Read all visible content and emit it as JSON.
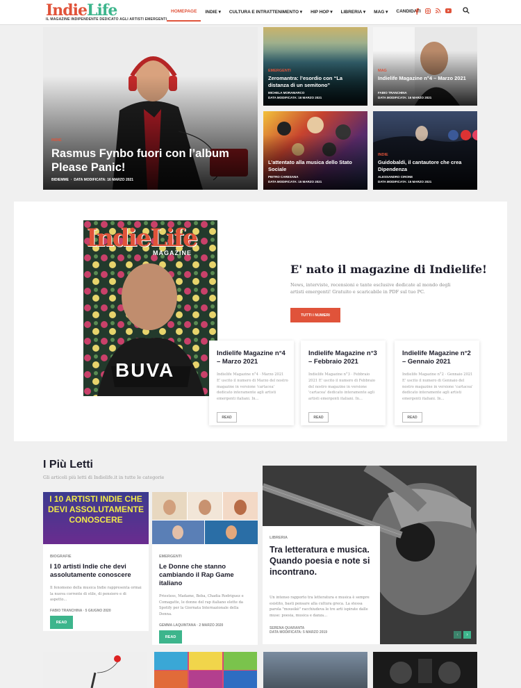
{
  "header": {
    "logo_part1": "Indie",
    "logo_part2": "Life",
    "tagline": "IL MAGAZINE INDIPENDENTE DEDICATO AGLI ARTISTI EMERGENTI",
    "nav": [
      "HOMEPAGE",
      "INDIE ▾",
      "CULTURA E INTRATTENIMENTO ▾",
      "HIP HOP ▾",
      "LIBRERIA ▾",
      "MAG ▾",
      "CANDIDATI"
    ]
  },
  "hero": {
    "main": {
      "category": "INDIE",
      "title": "Rasmus Fynbo fuori con l’album Please Panic!",
      "author": "BIDIEMME",
      "date": "DATA MODIFICATA: 16 MARZO 2021"
    },
    "tiles": [
      {
        "category": "EMERGENTI",
        "title": "Zeromantra: l’esordio con “La distanza di un semitono”",
        "author": "MICHELA MORAMARCO",
        "date": "DATA MODIFICATA: 16 MARZO 2021"
      },
      {
        "category": "MAG",
        "title": "Indielife Magazine n°4 – Marzo 2021",
        "author": "FABIO TRANCHINA",
        "date": "DATA MODIFICATA: 16 MARZO 2021"
      },
      {
        "category": "",
        "title": "L’attentato alla musica dello Stato Sociale",
        "author": "PIETRO CARESANA",
        "date": "DATA MODIFICATA: 15 MARZO 2021"
      },
      {
        "category": "INDIE",
        "title": "Guidobaldi, il cantautore che crea Dipendenza",
        "author": "ALESSANDRO CIRONE",
        "date": "DATA MODIFICATA: 15 MARZO 2021"
      }
    ]
  },
  "magazine": {
    "cover_logo": "IndieLife",
    "cover_sub": "MAGAZINE",
    "cover_name": "BUVA",
    "title": "E' nato il magazine di Indielife!",
    "description": "News, interviste, recensioni e tante esclusive dedicate al mondo degli artisti emergenti! Gratuito e scaricabile in PDF sul tuo PC.",
    "button": "TUTTI I NUMERI",
    "cards": [
      {
        "title": "Indielife Magazine n°4 – Marzo 2021",
        "excerpt": "Indielife Magazine n°4 · Marzo 2021 E' uscito il numero di Marzo del nostro magazine in versione 'cartacea' dedicato interamente agli artisti emergenti italiani. In...",
        "read": "READ"
      },
      {
        "title": "Indielife Magazine n°3 – Febbraio 2021",
        "excerpt": "Indielife Magazine n°3 · Febbraio 2021 E' uscito il numero di Febbraio del nostro magazine in versione 'cartacea' dedicato interamente agli artisti emergenti italiani. In...",
        "read": "READ"
      },
      {
        "title": "Indielife Magazine n°2 – Gennaio 2021",
        "excerpt": "Indielife Magazine n°2 · Gennaio 2021 E' uscito il numero di Gennaio del nostro magazine in versione 'cartacea' dedicato interamente agli artisti emergenti italiani. In...",
        "read": "READ"
      }
    ]
  },
  "popular": {
    "title": "I Più Letti",
    "subtitle": "Gli articoli più letti di Indielife.it in tutte le categorie",
    "posts": [
      {
        "image_text": "I 10 ARTISTI INDIE CHE DEVI ASSOLUTAMENTE CONOSCERE",
        "category": "BIOGRAFIE",
        "title": "I 10 artisti Indie che devi assolutamente conoscere",
        "excerpt": "Il fenomeno della musica Indie rappresenta ormai la nuova corrente di stile, di pensiero e di aspetto...",
        "author": "FABIO TRANCHINA",
        "date": "5 GIUGNO 2020",
        "read": "READ"
      },
      {
        "category": "EMERGENTI",
        "title": "Le Donne che stanno cambiando il Rap Game italiano",
        "excerpt": "Priestess, Madame, Beba, Chadia Rodriguez e Comagatte, le donne del rap italiano elette da Spotify per la Giornata Internazionale della Donna.",
        "author": "GEMMA LAQUINTANA",
        "date": "2 MARZO 2020",
        "read": "READ"
      }
    ],
    "featured": {
      "category": "LIBRERIA",
      "title": "Tra letteratura e musica. Quando poesia e note si incontrano.",
      "excerpt": "Un intenso rapporto tra letteratura e musica è sempre esistito, basti pensare alla cultura greca. La stessa parola \"mousikè\" racchiudeva le tre arti ispirate dalle muse: poesia, musica e danza...",
      "author": "SERENA QUARANTA",
      "date": "DATA MODIFICATA: 5 MARZO 2019"
    },
    "prev": "‹",
    "next": "›"
  },
  "colors": {
    "accent": "#e0533a",
    "green": "#3db58c"
  }
}
